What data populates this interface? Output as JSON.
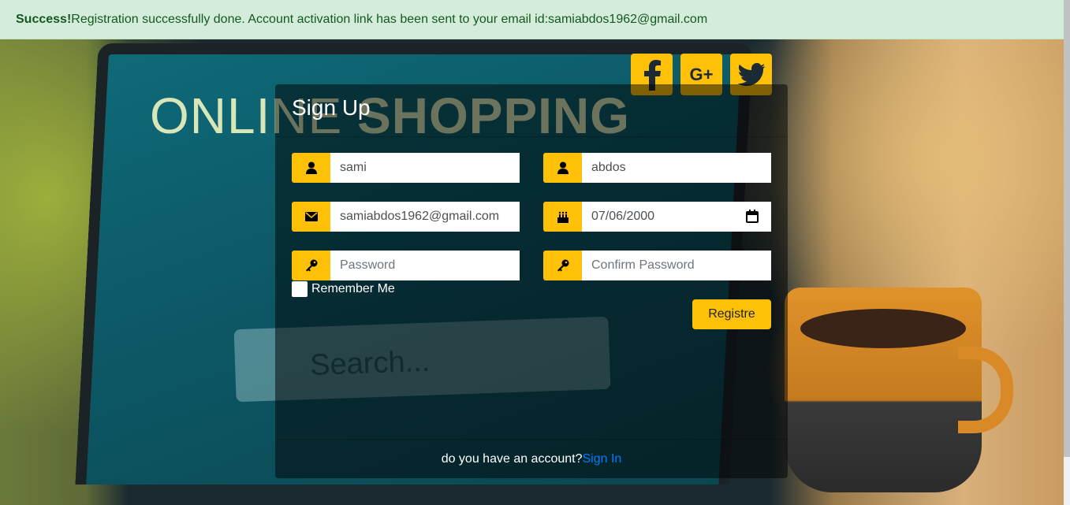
{
  "alert": {
    "strong": "Success!",
    "message": "Registration successfully done. Account activation link has been sent to your email id:samiabdos1962@gmail.com"
  },
  "background": {
    "screen_title_light": "ONLINE",
    "screen_title_bold": "SHOPPING",
    "screen_search": "Search..."
  },
  "social": [
    {
      "icon": "facebook-icon"
    },
    {
      "icon": "google-plus-icon",
      "label": "G+"
    },
    {
      "icon": "twitter-icon"
    }
  ],
  "card": {
    "title": "Sign Up",
    "fields": {
      "first_name": {
        "value": "sami",
        "icon": "user-icon"
      },
      "last_name": {
        "value": "abdos",
        "icon": "user-icon"
      },
      "email": {
        "value": "samiabdos1962@gmail.com",
        "icon": "envelope-icon"
      },
      "birthdate": {
        "value": "07/06/2000",
        "icon": "birthday-cake-icon"
      },
      "password": {
        "placeholder": "Password",
        "icon": "key-icon"
      },
      "confirm_password": {
        "placeholder": "Confirm Password",
        "icon": "key-icon"
      }
    },
    "remember_label": "Remember Me",
    "submit_label": "Registre",
    "footer_text": "do you have an account?",
    "footer_link": "Sign In"
  },
  "colors": {
    "accent": "#ffc107",
    "alert_bg": "#d4edda",
    "alert_text": "#155724",
    "link": "#007bff"
  }
}
